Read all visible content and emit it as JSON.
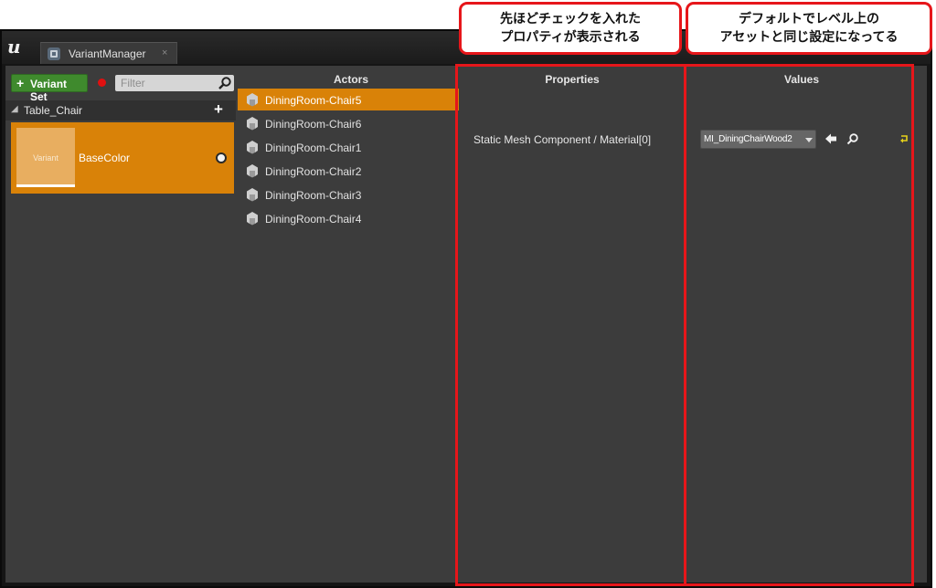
{
  "window": {
    "tab_label": "VariantManager",
    "tab_close": "×"
  },
  "left_panel": {
    "add_button_label": "Variant Set",
    "add_button_plus": "+",
    "filter_placeholder": "Filter",
    "variant_set": {
      "arrow": "◢",
      "name": "Table_Chair",
      "add": "+"
    },
    "variant": {
      "thumb_text": "Variant",
      "name": "BaseColor"
    }
  },
  "actors": {
    "header": "Actors",
    "items": [
      {
        "name": "DiningRoom-Chair5",
        "selected": true
      },
      {
        "name": "DiningRoom-Chair6",
        "selected": false
      },
      {
        "name": "DiningRoom-Chair1",
        "selected": false
      },
      {
        "name": "DiningRoom-Chair2",
        "selected": false
      },
      {
        "name": "DiningRoom-Chair3",
        "selected": false
      },
      {
        "name": "DiningRoom-Chair4",
        "selected": false
      }
    ]
  },
  "properties": {
    "header": "Properties",
    "items": [
      {
        "name": "Static Mesh Component / Material[0]"
      }
    ]
  },
  "values": {
    "header": "Values",
    "selected_value": "MI_DiningChairWood2"
  },
  "callouts": {
    "properties_line1": "先ほどチェックを入れた",
    "properties_line2": "プロパティが表示される",
    "values_line1": "デフォルトでレベル上の",
    "values_line2": "アセットと同じ設定になってる"
  },
  "colors": {
    "selection": "#d98208",
    "panel": "#3c3c3c",
    "highlight": "#e6161a",
    "add_button": "#3f8a2d"
  }
}
